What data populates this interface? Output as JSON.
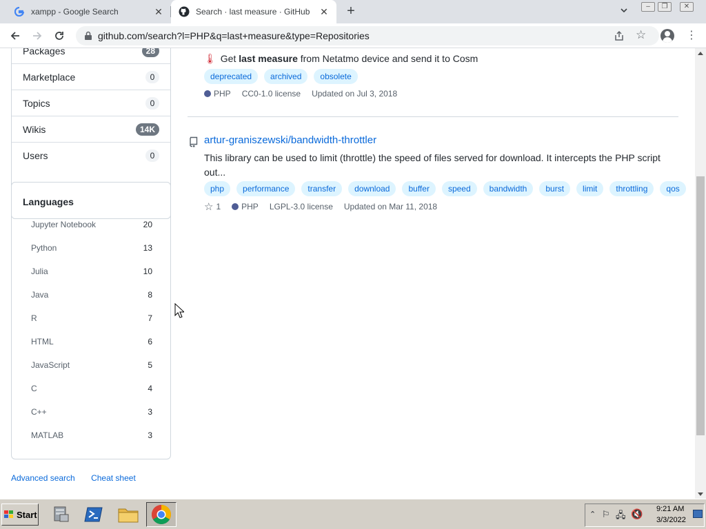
{
  "browser": {
    "tabs": [
      {
        "title": "xampp - Google Search",
        "icon": "google-icon"
      },
      {
        "title": "Search · last measure · GitHub",
        "icon": "github-icon"
      }
    ],
    "url": "github.com/search?l=PHP&q=last+measure&type=Repositories"
  },
  "sidebar": {
    "types": [
      {
        "label": "Packages",
        "count": "28"
      },
      {
        "label": "Marketplace",
        "count": "0"
      },
      {
        "label": "Topics",
        "count": "0"
      },
      {
        "label": "Wikis",
        "count": "14K"
      },
      {
        "label": "Users",
        "count": "0"
      }
    ],
    "languages_title": "Languages",
    "languages": [
      {
        "label": "Jupyter Notebook",
        "count": "20"
      },
      {
        "label": "Python",
        "count": "13"
      },
      {
        "label": "Julia",
        "count": "10"
      },
      {
        "label": "Java",
        "count": "8"
      },
      {
        "label": "R",
        "count": "7"
      },
      {
        "label": "HTML",
        "count": "6"
      },
      {
        "label": "JavaScript",
        "count": "5"
      },
      {
        "label": "C",
        "count": "4"
      },
      {
        "label": "C++",
        "count": "3"
      },
      {
        "label": "MATLAB",
        "count": "3"
      }
    ],
    "advanced_search": "Advanced search",
    "cheat_sheet": "Cheat sheet"
  },
  "results": [
    {
      "desc_prefix": "Get ",
      "desc_bold": "last measure",
      "desc_suffix": " from Netatmo device and send it to Cosm",
      "topics": [
        "deprecated",
        "archived",
        "obsolete"
      ],
      "language": "PHP",
      "language_color": "#4F5D95",
      "license": "CC0-1.0 license",
      "updated": "Updated on Jul 3, 2018"
    },
    {
      "title": "artur-graniszewski/bandwidth-throttler",
      "desc": "This library can be used to limit (throttle) the speed of files served for download. It intercepts the PHP script out...",
      "topics": [
        "php",
        "performance",
        "transfer",
        "download",
        "buffer",
        "speed",
        "bandwidth",
        "burst",
        "limit",
        "throttling",
        "qos"
      ],
      "stars": "1",
      "language": "PHP",
      "language_color": "#4F5D95",
      "license": "LGPL-3.0 license",
      "updated": "Updated on Mar 11, 2018"
    }
  ],
  "taskbar": {
    "start": "Start",
    "time": "9:21 AM",
    "date": "3/3/2022"
  }
}
